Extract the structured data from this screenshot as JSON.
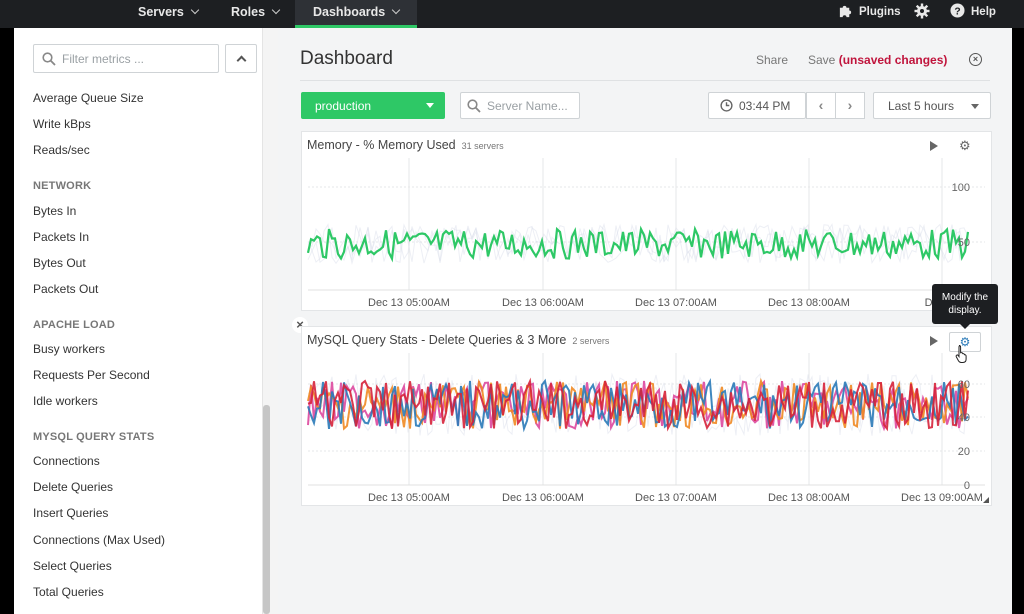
{
  "nav": {
    "items": [
      {
        "label": "Servers"
      },
      {
        "label": "Roles"
      },
      {
        "label": "Dashboards"
      }
    ],
    "plugins": "Plugins",
    "help": "Help"
  },
  "sidebar": {
    "filter_placeholder": "Filter metrics ...",
    "items_top": [
      "Average Queue Size",
      "Write kBps",
      "Reads/sec"
    ],
    "sections": [
      {
        "title": "NETWORK",
        "items": [
          "Bytes In",
          "Packets In",
          "Bytes Out",
          "Packets Out"
        ]
      },
      {
        "title": "APACHE LOAD",
        "items": [
          "Busy workers",
          "Requests Per Second",
          "Idle workers"
        ]
      },
      {
        "title": "MYSQL QUERY STATS",
        "items": [
          "Connections",
          "Delete Queries",
          "Insert Queries",
          "Connections (Max Used)",
          "Select Queries",
          "Total Queries"
        ]
      }
    ]
  },
  "main": {
    "title": "Dashboard",
    "share": "Share",
    "save": "Save",
    "unsaved": "(unsaved changes)",
    "environment": "production",
    "server_placeholder": "Server Name...",
    "time": "03:44 PM",
    "range": "Last 5 hours"
  },
  "panels": [
    {
      "title": "Memory - % Memory Used",
      "subtitle": "31 servers",
      "y_ticks": [
        "100",
        "50"
      ],
      "x_ticks": [
        "Dec 13 05:00AM",
        "Dec 13 06:00AM",
        "Dec 13 07:00AM",
        "Dec 13 08:00AM",
        "Dec 13"
      ]
    },
    {
      "title": "MySQL Query Stats - Delete Queries & 3 More",
      "subtitle": "2 servers",
      "y_ticks": [
        "60",
        "40",
        "20",
        "0"
      ],
      "x_ticks": [
        "Dec 13 05:00AM",
        "Dec 13 06:00AM",
        "Dec 13 07:00AM",
        "Dec 13 08:00AM",
        "Dec 13 09:00AM"
      ]
    }
  ],
  "tooltip": {
    "text": "Modify the display."
  },
  "colors": {
    "accent_green": "#2ec866",
    "unsaved_red": "#c0143c",
    "nav_bg": "#1d1f22",
    "series_memory": "#2ec866",
    "series_mysql": [
      "#d6223a",
      "#2a7ab8",
      "#f08a24",
      "#e05aa8"
    ]
  },
  "icons": {
    "plugins": "puzzle-icon",
    "settings": "gear-icon",
    "help": "help-icon",
    "search": "search-icon",
    "clock": "clock-icon"
  }
}
